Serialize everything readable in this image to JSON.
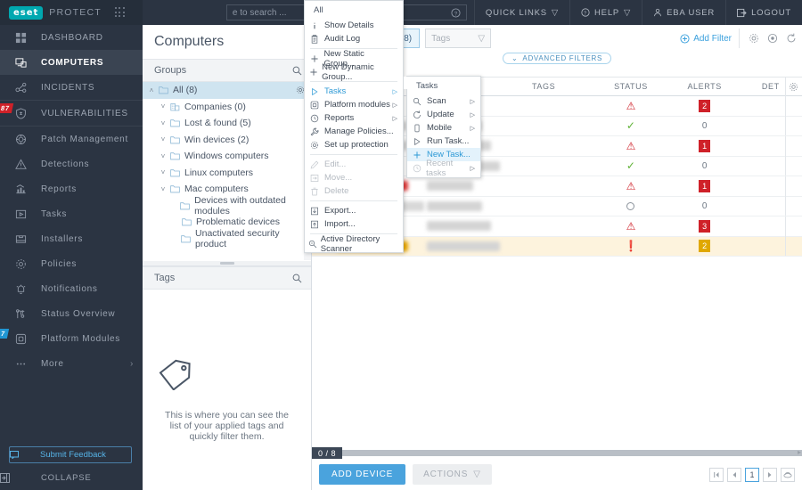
{
  "brand": {
    "logo_text": "eset",
    "product": "PROTECT",
    "apps_icon": "grid-dots-icon"
  },
  "topbar": {
    "search_placeholder": "e to search ...",
    "search_help_icon": "question-circle-icon",
    "quick_links": "QUICK LINKS",
    "help": "HELP",
    "user": "EBA USER",
    "logout": "LOGOUT"
  },
  "sidebar": {
    "items": [
      {
        "label": "DASHBOARD",
        "icon": "dashboard-icon",
        "active": false,
        "badge": null
      },
      {
        "label": "COMPUTERS",
        "icon": "monitor-icon",
        "active": true,
        "badge": null
      },
      {
        "label": "INCIDENTS",
        "icon": "share-nodes-icon",
        "active": false,
        "badge": null
      },
      {
        "label": "VULNERABILITIES",
        "icon": "shield-bug-icon",
        "active": false,
        "badge": "87",
        "badge_color": "#cf2129"
      },
      {
        "label": "Patch Management",
        "icon": "patch-icon",
        "active": false,
        "badge": null
      },
      {
        "label": "Detections",
        "icon": "warning-triangle-icon",
        "active": false,
        "badge": null
      },
      {
        "label": "Reports",
        "icon": "report-chart-icon",
        "active": false,
        "badge": null
      },
      {
        "label": "Tasks",
        "icon": "task-play-icon",
        "active": false,
        "badge": null
      },
      {
        "label": "Installers",
        "icon": "installer-box-icon",
        "active": false,
        "badge": null
      },
      {
        "label": "Policies",
        "icon": "policy-gear-icon",
        "active": false,
        "badge": null
      },
      {
        "label": "Notifications",
        "icon": "bell-icon",
        "active": false,
        "badge": null
      },
      {
        "label": "Status Overview",
        "icon": "status-overview-icon",
        "active": false,
        "badge": null
      },
      {
        "label": "Platform Modules",
        "icon": "module-icon",
        "active": false,
        "badge": "7",
        "badge_color": "#2196d3"
      },
      {
        "label": "More",
        "icon": "ellipsis-icon",
        "active": false,
        "badge": null,
        "chevron": "›"
      }
    ],
    "feedback_label": "Submit Feedback",
    "collapse_label": "COLLAPSE"
  },
  "page": {
    "title": "Computers"
  },
  "groups_panel": {
    "header": "Groups",
    "search_icon": "search-icon",
    "tree": [
      {
        "label": "All (8)",
        "indent": 0,
        "caret": "˄",
        "icon": "folder-icon",
        "selected": true,
        "gear": "gear-icon"
      },
      {
        "label": "Companies (0)",
        "indent": 1,
        "caret": "˅",
        "icon": "company-icon",
        "selected": false
      },
      {
        "label": "Lost & found (5)",
        "indent": 1,
        "caret": "˅",
        "icon": "folder-icon",
        "selected": false
      },
      {
        "label": "Win devices (2)",
        "indent": 1,
        "caret": "˅",
        "icon": "folder-icon",
        "selected": false
      },
      {
        "label": "Windows computers",
        "indent": 1,
        "caret": "˅",
        "icon": "folder-icon",
        "selected": false
      },
      {
        "label": "Linux computers",
        "indent": 1,
        "caret": "˅",
        "icon": "folder-icon",
        "selected": false
      },
      {
        "label": "Mac computers",
        "indent": 1,
        "caret": "˅",
        "icon": "folder-icon",
        "selected": false
      },
      {
        "label": "Devices with outdated modules",
        "indent": 2,
        "caret": "",
        "icon": "folder-icon",
        "selected": false
      },
      {
        "label": "Problematic devices",
        "indent": 2,
        "caret": "",
        "icon": "folder-icon",
        "selected": false
      },
      {
        "label": "Unactivated security product",
        "indent": 2,
        "caret": "",
        "icon": "folder-icon",
        "selected": false
      }
    ]
  },
  "tags_panel": {
    "header": "Tags",
    "search_icon": "search-icon",
    "empty_icon": "tag-icon",
    "empty_text": "This is where you can see the list of your applied tags and quickly filter them."
  },
  "filterbar": {
    "group_view_icon": "group-view-icon",
    "check_icon": "check-icon",
    "all_label": "All (8)",
    "all_icon": "folder-icon",
    "tags_placeholder": "Tags",
    "tags_caret": "chevron-down-icon",
    "add_filter": "Add Filter",
    "add_filter_icon": "plus-circle-icon",
    "right_icons": [
      "gear-icon",
      "target-icon",
      "refresh-icon"
    ],
    "advanced_filters": "ADVANCED FILTERS",
    "advanced_filters_icon": "chevron-double-down-icon"
  },
  "table": {
    "columns": [
      "",
      "",
      "",
      "TAGS",
      "STATUS",
      "ALERTS",
      "DET",
      ""
    ],
    "gear_icon": "column-settings-icon",
    "rows": [
      {
        "checked": false,
        "name_redacted": true,
        "name_color": "#d8d8d8",
        "os_redacted": true,
        "tags": "",
        "status": "alert",
        "alerts": "2",
        "alerts_kind": "red",
        "highlight": false
      },
      {
        "checked": false,
        "name_redacted": true,
        "name_color": "#d8d8d8",
        "os_redacted": true,
        "tags": "",
        "status": "ok",
        "alerts": "0",
        "alerts_kind": "zero",
        "highlight": false
      },
      {
        "checked": false,
        "name_redacted": true,
        "name_color": "#d8d8d8",
        "os_redacted": true,
        "tags": "",
        "status": "alert",
        "alerts": "1",
        "alerts_kind": "red",
        "highlight": false
      },
      {
        "checked": false,
        "name_redacted": true,
        "name_color": "#d8d8d8",
        "os_redacted": true,
        "tags": "",
        "status": "ok",
        "alerts": "0",
        "alerts_kind": "zero",
        "highlight": false
      },
      {
        "checked": false,
        "name_redacted": true,
        "name_color": "#e03a3a",
        "os_redacted": true,
        "tags": "",
        "status": "alert",
        "alerts": "1",
        "alerts_kind": "red",
        "highlight": false
      },
      {
        "checked": false,
        "name_redacted": true,
        "name_color": "#d8d8d8",
        "os_redacted": true,
        "tags": "",
        "status": "idle",
        "alerts": "0",
        "alerts_kind": "zero",
        "highlight": false
      },
      {
        "checked": false,
        "name_redacted": true,
        "name_color": "#e03a3a",
        "os_redacted": true,
        "tags": "",
        "status": "alert",
        "alerts": "3",
        "alerts_kind": "red",
        "highlight": false
      },
      {
        "checked": false,
        "name_redacted": true,
        "name_color": "#eaa800",
        "os_redacted": true,
        "tags": "",
        "status": "warn",
        "alerts": "2",
        "alerts_kind": "amber",
        "highlight": true
      }
    ]
  },
  "footer": {
    "counter": "0 / 8",
    "add_device": "ADD DEVICE",
    "actions": "ACTIONS",
    "actions_caret": "chevron-down-icon",
    "pager": {
      "first_icon": "page-first-icon",
      "prev_icon": "page-prev-icon",
      "current": "1",
      "next_icon": "page-next-icon",
      "last_icon": "page-last-icon"
    }
  },
  "context_menu": {
    "title": "All",
    "items": [
      {
        "label": "Show Details",
        "icon": "info-icon",
        "state": "normal",
        "arrow": false
      },
      {
        "label": "Audit Log",
        "icon": "clipboard-icon",
        "state": "normal",
        "arrow": false
      },
      {
        "sep": true
      },
      {
        "label": "New Static Group...",
        "icon": "plus-icon",
        "state": "normal",
        "arrow": false
      },
      {
        "label": "New Dynamic Group...",
        "icon": "plus-icon",
        "state": "normal",
        "arrow": false
      },
      {
        "sep": true
      },
      {
        "label": "Tasks",
        "icon": "play-icon",
        "state": "selected",
        "arrow": true
      },
      {
        "label": "Platform modules",
        "icon": "module-icon",
        "state": "normal",
        "arrow": true
      },
      {
        "label": "Reports",
        "icon": "clock-icon",
        "state": "normal",
        "arrow": true
      },
      {
        "label": "Manage Policies...",
        "icon": "wrench-icon",
        "state": "normal",
        "arrow": false
      },
      {
        "label": "Set up protection",
        "icon": "gear-icon",
        "state": "normal",
        "arrow": false
      },
      {
        "sep": true
      },
      {
        "label": "Edit...",
        "icon": "pencil-icon",
        "state": "disabled",
        "arrow": false
      },
      {
        "label": "Move...",
        "icon": "move-icon",
        "state": "disabled",
        "arrow": false
      },
      {
        "label": "Delete",
        "icon": "trash-icon",
        "state": "disabled",
        "arrow": false
      },
      {
        "sep": true
      },
      {
        "label": "Export...",
        "icon": "export-icon",
        "state": "normal",
        "arrow": false
      },
      {
        "label": "Import...",
        "icon": "import-icon",
        "state": "normal",
        "arrow": false
      },
      {
        "sep": true
      },
      {
        "label": "Active Directory Scanner",
        "icon": "ad-scan-icon",
        "state": "normal",
        "arrow": false
      }
    ]
  },
  "tasks_submenu": {
    "title": "Tasks",
    "items": [
      {
        "label": "Scan",
        "icon": "search-icon",
        "state": "normal",
        "arrow": true
      },
      {
        "label": "Update",
        "icon": "refresh-icon",
        "state": "normal",
        "arrow": true
      },
      {
        "label": "Mobile",
        "icon": "mobile-icon",
        "state": "normal",
        "arrow": true
      },
      {
        "label": "Run Task...",
        "icon": "play-icon",
        "state": "normal",
        "arrow": false
      },
      {
        "label": "New Task...",
        "icon": "plus-icon",
        "state": "new",
        "arrow": false
      },
      {
        "label": "Recent tasks",
        "icon": "clock-icon",
        "state": "disabled",
        "arrow": true
      }
    ]
  },
  "colors": {
    "sidebar_bg": "#2b3442",
    "accent_blue": "#3aa0dd",
    "brand_teal": "#00a8b0",
    "alert_red": "#cf2129",
    "ok_green": "#5fb236",
    "warn_amber": "#e0a800",
    "highlight_row": "#fdf3dd",
    "tree_selected": "#cfe4f0"
  }
}
